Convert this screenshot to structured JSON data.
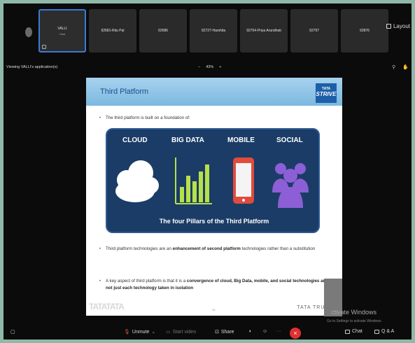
{
  "participants": [
    {
      "name": "VALLI",
      "role": "Host"
    },
    {
      "name": "92681-Ritu Pal"
    },
    {
      "name": "92686"
    },
    {
      "name": "92727-Harshita"
    },
    {
      "name": "92764-Priya Arundhati"
    },
    {
      "name": "92797"
    },
    {
      "name": "92876"
    }
  ],
  "layout_label": "Layout",
  "viewing_text": "Viewing VALLI's application(s)",
  "zoom": {
    "minus": "−",
    "value": "43%",
    "plus": "+"
  },
  "slide": {
    "title": "Third Platform",
    "logo_top": "TATA",
    "logo_bottom": "STRIVE",
    "intro_bullet": "The third platform is built on a foundation of:",
    "pillars": [
      "CLOUD",
      "BIG DATA",
      "MOBILE",
      "SOCIAL"
    ],
    "pillars_caption": "The four Pillars of the Third Platform",
    "bullet2": {
      "a": "Third platform technologies are an ",
      "b": "enhancement of second platform",
      "c": " technologies rather than a substitution"
    },
    "bullet3": {
      "a": "A key aspect of third platform is that it is a ",
      "b": "convergence of cloud, Big Data, mobile, and social technologies and not just each technology taken in isolation",
      "c": ""
    },
    "footer_brand": "TATA TRUSTS",
    "watermark": "TATATATA",
    "page_no": "35"
  },
  "overlay": {
    "activate": "ctivate Windows",
    "activate_sub": "Go to Settings to activate Windows."
  },
  "toolbar": {
    "unmute": "Unmute",
    "start_video": "Start video",
    "share": "Share",
    "chat": "Chat",
    "qa": "Q & A"
  },
  "colors": {
    "accent": "#3a7bd5",
    "end": "#e03030",
    "pillar_bg": "#1b3c66"
  }
}
